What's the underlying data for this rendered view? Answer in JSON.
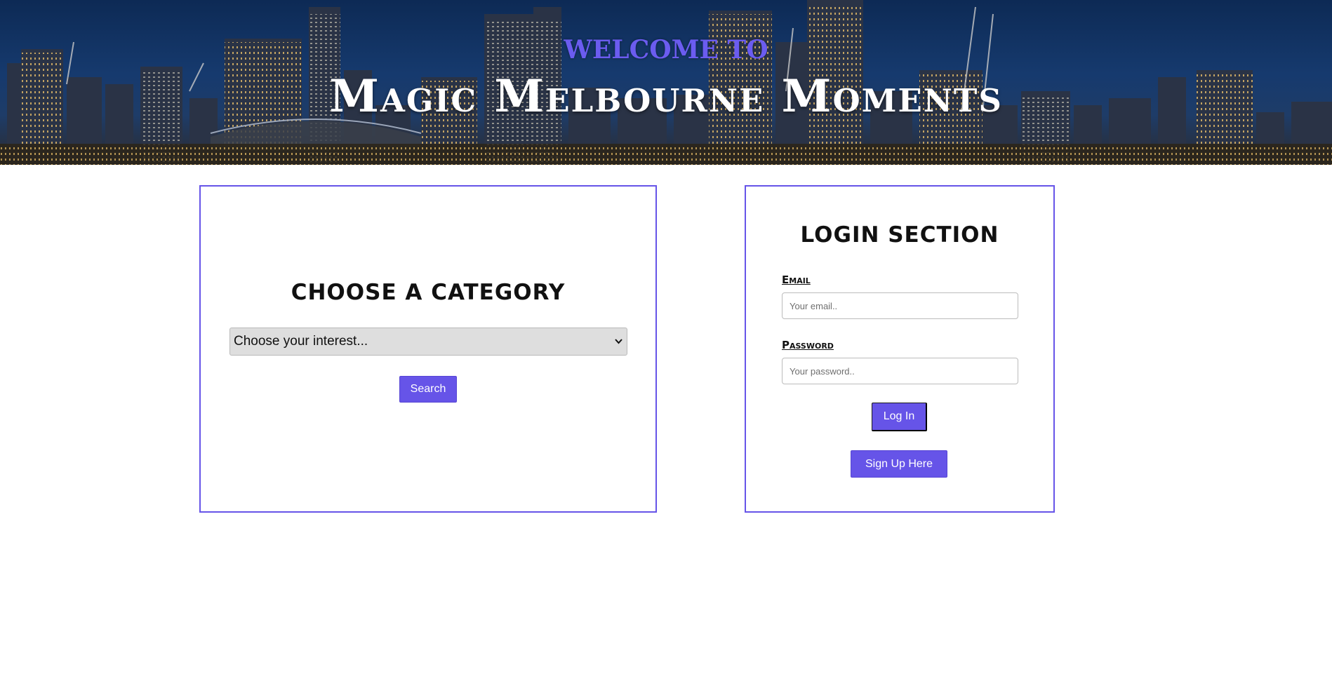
{
  "hero": {
    "overline": "Welcome to",
    "title": "Magic Melbourne Moments"
  },
  "category": {
    "heading": "Choose a Category",
    "select_value": "Choose your interest...",
    "search_label": "Search"
  },
  "login": {
    "heading": "Login Section",
    "email_label": "Email",
    "email_placeholder": "Your email..",
    "password_label": "Password",
    "password_placeholder": "Your password..",
    "login_label": "Log In",
    "signup_label": "Sign Up Here"
  },
  "icons": {
    "select_chevron": "chevron-down-icon"
  },
  "colors": {
    "accent": "#6654e8",
    "overline": "#6b5cf0",
    "hero_sky": "#163a6e"
  }
}
